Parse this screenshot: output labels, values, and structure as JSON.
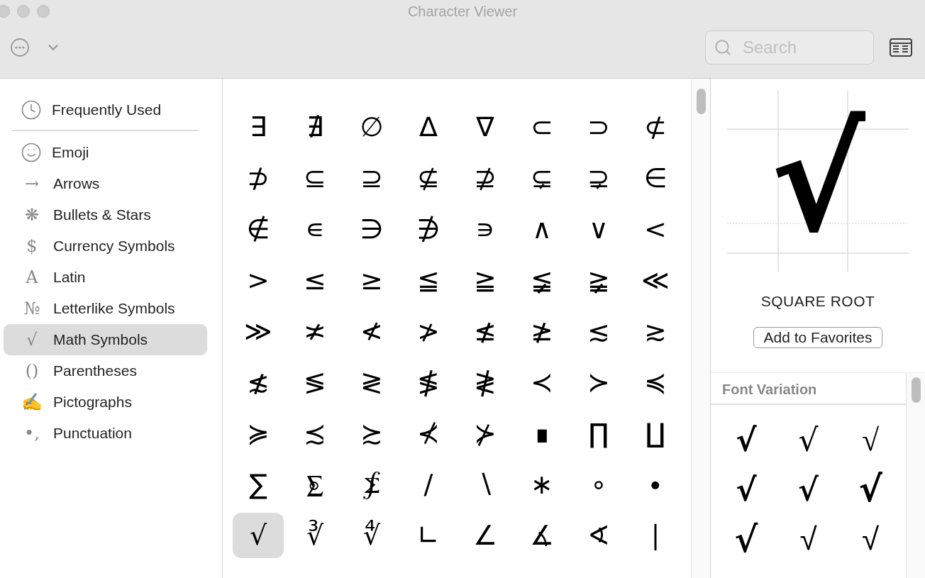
{
  "window": {
    "title": "Character Viewer"
  },
  "toolbar": {
    "search": {
      "placeholder": "Search"
    }
  },
  "sidebar": {
    "pinned": {
      "label": "Frequently Used",
      "selected": false
    },
    "items": [
      {
        "label": "Emoji",
        "selected": false
      },
      {
        "label": "Arrows",
        "glyph": "→",
        "selected": false
      },
      {
        "label": "Bullets & Stars",
        "glyph": "❋",
        "selected": false
      },
      {
        "label": "Currency Symbols",
        "glyph": "$",
        "selected": false
      },
      {
        "label": "Latin",
        "glyph": "A",
        "selected": false
      },
      {
        "label": "Letterlike Symbols",
        "glyph": "№",
        "selected": false
      },
      {
        "label": "Math Symbols",
        "glyph": "√",
        "selected": true
      },
      {
        "label": "Parentheses",
        "glyph": "()",
        "selected": false
      },
      {
        "label": "Pictographs",
        "glyph": "✍",
        "selected": false
      },
      {
        "label": "Punctuation",
        "glyph": "•,",
        "selected": false
      }
    ]
  },
  "grid": {
    "rows": [
      [
        {
          "char": "∃",
          "selected": false
        },
        {
          "char": "∄",
          "selected": false
        },
        {
          "char": "∅",
          "selected": false
        },
        {
          "char": "∆",
          "selected": false
        },
        {
          "char": "∇",
          "selected": false
        },
        {
          "char": "⊂",
          "selected": false
        },
        {
          "char": "⊃",
          "selected": false
        },
        {
          "char": "⊄",
          "selected": false
        }
      ],
      [
        {
          "char": "⊅",
          "selected": false
        },
        {
          "char": "⊆",
          "selected": false
        },
        {
          "char": "⊇",
          "selected": false
        },
        {
          "char": "⊈",
          "selected": false
        },
        {
          "char": "⊉",
          "selected": false
        },
        {
          "char": "⊊",
          "selected": false
        },
        {
          "char": "⊋",
          "selected": false
        },
        {
          "char": "∈",
          "selected": false
        }
      ],
      [
        {
          "char": "∉",
          "selected": false
        },
        {
          "char": "∊",
          "selected": false
        },
        {
          "char": "∋",
          "selected": false
        },
        {
          "char": "∌",
          "selected": false
        },
        {
          "char": "∍",
          "selected": false
        },
        {
          "char": "∧",
          "selected": false
        },
        {
          "char": "∨",
          "selected": false
        },
        {
          "char": "<",
          "selected": false
        }
      ],
      [
        {
          "char": ">",
          "selected": false
        },
        {
          "char": "≤",
          "selected": false
        },
        {
          "char": "≥",
          "selected": false
        },
        {
          "char": "≦",
          "selected": false
        },
        {
          "char": "≧",
          "selected": false
        },
        {
          "char": "≨",
          "selected": false
        },
        {
          "char": "≩",
          "selected": false
        },
        {
          "char": "≪",
          "selected": false
        }
      ],
      [
        {
          "char": "≫",
          "selected": false
        },
        {
          "char": "≭",
          "selected": false
        },
        {
          "char": "≮",
          "selected": false
        },
        {
          "char": "≯",
          "selected": false
        },
        {
          "char": "≰",
          "selected": false
        },
        {
          "char": "≱",
          "selected": false
        },
        {
          "char": "≲",
          "selected": false
        },
        {
          "char": "≳",
          "selected": false
        }
      ],
      [
        {
          "char": "≴",
          "selected": false
        },
        {
          "char": "≶",
          "selected": false
        },
        {
          "char": "≷",
          "selected": false
        },
        {
          "char": "≸",
          "selected": false
        },
        {
          "char": "≹",
          "selected": false
        },
        {
          "char": "≺",
          "selected": false
        },
        {
          "char": "≻",
          "selected": false
        },
        {
          "char": "≼",
          "selected": false
        }
      ],
      [
        {
          "char": "≽",
          "selected": false
        },
        {
          "char": "≾",
          "selected": false
        },
        {
          "char": "≿",
          "selected": false
        },
        {
          "char": "⊀",
          "selected": false
        },
        {
          "char": "⊁",
          "selected": false
        },
        {
          "char": "∎",
          "selected": false
        },
        {
          "char": "∏",
          "selected": false
        },
        {
          "char": "∐",
          "selected": false
        }
      ],
      [
        {
          "char": "∑",
          "selected": false
        },
        {
          "char": "⨊",
          "selected": false
        },
        {
          "char": "⨋",
          "selected": false
        },
        {
          "char": "∕",
          "selected": false
        },
        {
          "char": "∖",
          "selected": false
        },
        {
          "char": "∗",
          "selected": false
        },
        {
          "char": "∘",
          "selected": false
        },
        {
          "char": "∙",
          "selected": false
        }
      ],
      [
        {
          "char": "√",
          "selected": true
        },
        {
          "char": "∛",
          "selected": false
        },
        {
          "char": "∜",
          "selected": false
        },
        {
          "char": "∟",
          "selected": false
        },
        {
          "char": "∠",
          "selected": false
        },
        {
          "char": "∡",
          "selected": false
        },
        {
          "char": "∢",
          "selected": false
        },
        {
          "char": "∣",
          "selected": false
        }
      ]
    ]
  },
  "detail": {
    "glyph": "√",
    "name": "SQUARE ROOT",
    "favorite_button": "Add to Favorites",
    "font_variation": {
      "title": "Font Variation",
      "variants": [
        "√",
        "√",
        "√",
        "√",
        "√",
        "√",
        "√",
        "√",
        "√"
      ]
    }
  }
}
